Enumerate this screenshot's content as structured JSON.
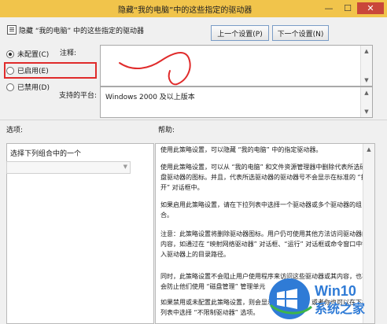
{
  "window": {
    "title": "隐藏“我的电脑”中的这些指定的驱动器",
    "min": "—",
    "max": "☐",
    "close": "✕"
  },
  "header": {
    "policy_name": "隐藏 “我的电脑” 中的这些指定的驱动器",
    "prev_button": "上一个设置(P)",
    "next_button": "下一个设置(N)"
  },
  "state": {
    "options": [
      {
        "label": "未配置(C)",
        "selected": true
      },
      {
        "label": "已启用(E)",
        "selected": false
      },
      {
        "label": "已禁用(D)",
        "selected": false
      }
    ]
  },
  "comment": {
    "label": "注释:",
    "value": ""
  },
  "platform": {
    "label": "支持的平台:",
    "value": "Windows 2000 及以上版本"
  },
  "options_section": {
    "label": "选项:",
    "combo_label": "选择下列组合中的一个",
    "combo_value": ""
  },
  "help_section": {
    "label": "帮助:",
    "paragraphs": [
      "使用此策略设置，可以隐藏 “我的电脑” 中的指定驱动器。",
      "使用此策略设置，可以从 “我的电脑” 和文件资源管理器中删除代表所选硬盘驱动器的图标。并且，代表所选驱动器的驱动器号不会显示在标准的 “打开” 对话框中。",
      "如果启用此策略设置，请在下拉列表中选择一个驱动器或多个驱动器的组合。",
      "注意：此策略设置将删除驱动器图标。用户仍可使用其他方法访问驱动器的内容，如通过在 “映射网络驱动器” 对话框、“运行” 对话框或命令窗口中键入驱动器上的目录路径。",
      "同时，此策略设置不会阻止用户使用程序来访问这些驱动器或其内容，也不会防止他们使用 “磁盘管理” 管理单元",
      "如果禁用或未配置此策略设置，则会显示所有驱动器，或者你也可以在下拉列表中选择 “不限制驱动器” 选项。"
    ]
  },
  "watermark": {
    "brand": "Win10",
    "tagline": "系统之家"
  },
  "colors": {
    "titlebar": "#f1c44b",
    "highlight": "#e02b2b",
    "accent": "#2f7bd6"
  }
}
